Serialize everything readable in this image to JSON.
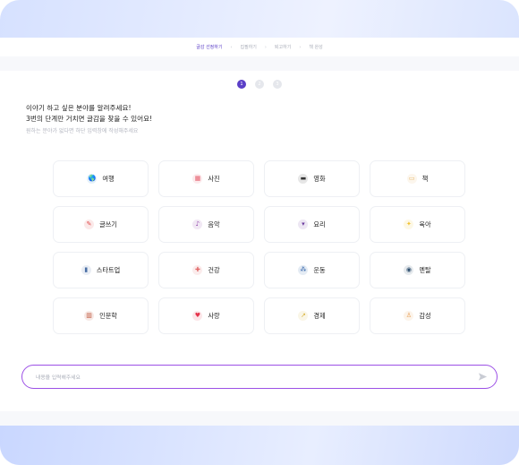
{
  "breadcrumb": [
    {
      "label": "글감 선정하기",
      "active": true
    },
    {
      "label": "집필하기",
      "active": false
    },
    {
      "label": "퇴고하기",
      "active": false
    },
    {
      "label": "책 완성",
      "active": false
    }
  ],
  "steps": [
    {
      "label": "1",
      "active": true
    },
    {
      "label": "2",
      "active": false
    },
    {
      "label": "3",
      "active": false
    }
  ],
  "question": {
    "line1": "이야기 하고 싶은 분야를 알려주세요!",
    "line2": "3번의 단계만 거치면 글감을 찾을 수 있어요!",
    "hint": "원하는 분야가 없다면 하단 입력창에 작성해주세요"
  },
  "categories": [
    {
      "label": "여행",
      "icon": "globe-icon",
      "glyph": "🌎",
      "color": "#2b8fd6"
    },
    {
      "label": "사진",
      "icon": "photo-album-icon",
      "glyph": "▦",
      "color": "#e45b6b"
    },
    {
      "label": "영화",
      "icon": "film-clapper-icon",
      "glyph": "▬",
      "color": "#333333"
    },
    {
      "label": "책",
      "icon": "book-icon",
      "glyph": "▭",
      "color": "#e8b86a"
    },
    {
      "label": "글쓰기",
      "icon": "pencil-icon",
      "glyph": "✎",
      "color": "#e04b4b"
    },
    {
      "label": "음악",
      "icon": "microphone-icon",
      "glyph": "♪",
      "color": "#8e3fa8"
    },
    {
      "label": "요리",
      "icon": "cocktail-icon",
      "glyph": "▾",
      "color": "#6a3a9e"
    },
    {
      "label": "육아",
      "icon": "baby-bottle-icon",
      "glyph": "✦",
      "color": "#f1c232"
    },
    {
      "label": "스타트업",
      "icon": "building-icon",
      "glyph": "▮",
      "color": "#4a6fa5"
    },
    {
      "label": "건강",
      "icon": "medicine-icon",
      "glyph": "✚",
      "color": "#e06666"
    },
    {
      "label": "운동",
      "icon": "dumbbell-icon",
      "glyph": "⁂",
      "color": "#2d5fa8"
    },
    {
      "label": "멘탈",
      "icon": "eye-icon",
      "glyph": "◉",
      "color": "#2f4f6f"
    },
    {
      "label": "인문학",
      "icon": "books-icon",
      "glyph": "▥",
      "color": "#c0553a"
    },
    {
      "label": "사랑",
      "icon": "heart-icon",
      "glyph": "♥",
      "color": "#e5334b"
    },
    {
      "label": "경제",
      "icon": "chart-up-icon",
      "glyph": "↗",
      "color": "#d9b23a"
    },
    {
      "label": "감성",
      "icon": "person-lotus-icon",
      "glyph": "♙",
      "color": "#e9a25b"
    }
  ],
  "input": {
    "placeholder": "내용을 입력해주세요",
    "send_icon": "send-icon"
  },
  "colors": {
    "accent": "#5b3fc7",
    "input_border": "#9c50e6"
  }
}
